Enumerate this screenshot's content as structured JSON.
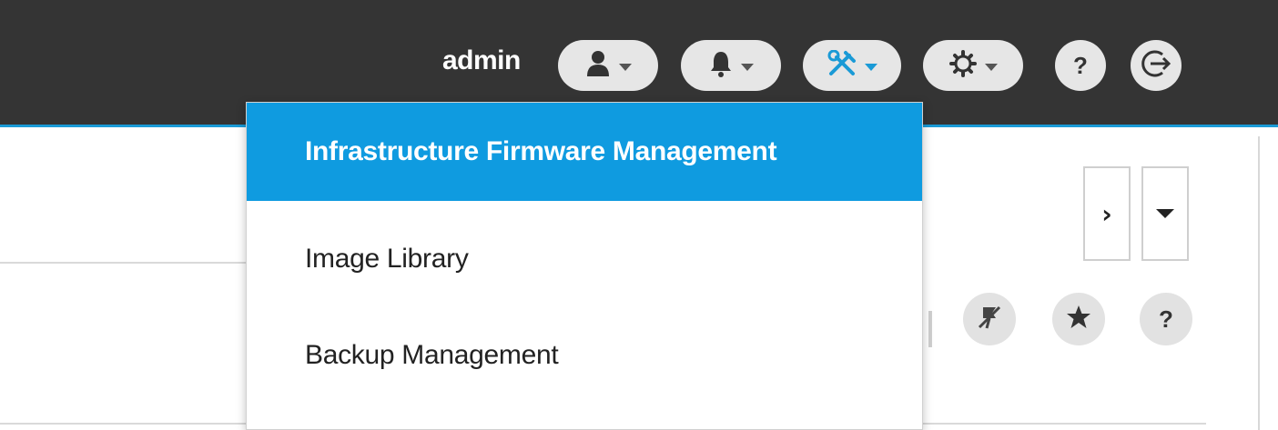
{
  "header": {
    "username": "admin",
    "menus": [
      {
        "name": "user-menu-button",
        "icon": "user-icon",
        "active": false
      },
      {
        "name": "notifications-menu-button",
        "icon": "bell-icon",
        "active": false
      },
      {
        "name": "tools-menu-button",
        "icon": "tools-icon",
        "active": true
      },
      {
        "name": "settings-menu-button",
        "icon": "gear-icon",
        "active": false
      }
    ],
    "help_label": "?",
    "logout_icon": "logout-icon",
    "accent_color": "#1a9ad6"
  },
  "tools_dropdown": {
    "items": [
      {
        "label": "Infrastructure Firmware Management",
        "active": true
      },
      {
        "label": "Image Library",
        "active": false
      },
      {
        "label": "Backup Management",
        "active": false
      }
    ],
    "active_color": "#0f9be0"
  },
  "panel": {
    "next_label": "›",
    "actions": [
      {
        "icon": "unpin-icon"
      },
      {
        "icon": "star-icon"
      },
      {
        "icon": "help-icon",
        "label": "?"
      }
    ]
  }
}
